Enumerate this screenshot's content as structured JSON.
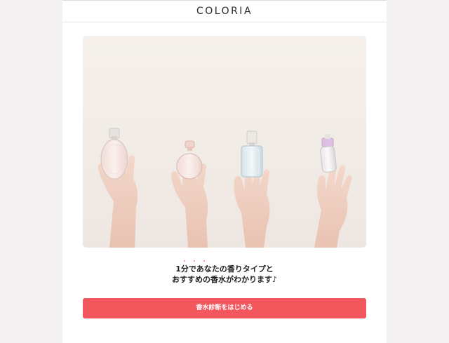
{
  "brand": {
    "logo_text": "COLORIA"
  },
  "hero": {
    "image_subject": "four hands holding perfume bottles",
    "background_color": "#f3eeea"
  },
  "lead": {
    "emphasis_marks": "・・・",
    "line1": "1分であなたの香りタイプと",
    "line2": "おすすめの香水がわかります♪"
  },
  "cta": {
    "label": "香水診断をはじめる",
    "color": "#f2575d"
  },
  "colors": {
    "page_background": "#f4f2f2",
    "content_background": "#ffffff",
    "accent": "#f2575d",
    "text": "#1e1e1e"
  }
}
